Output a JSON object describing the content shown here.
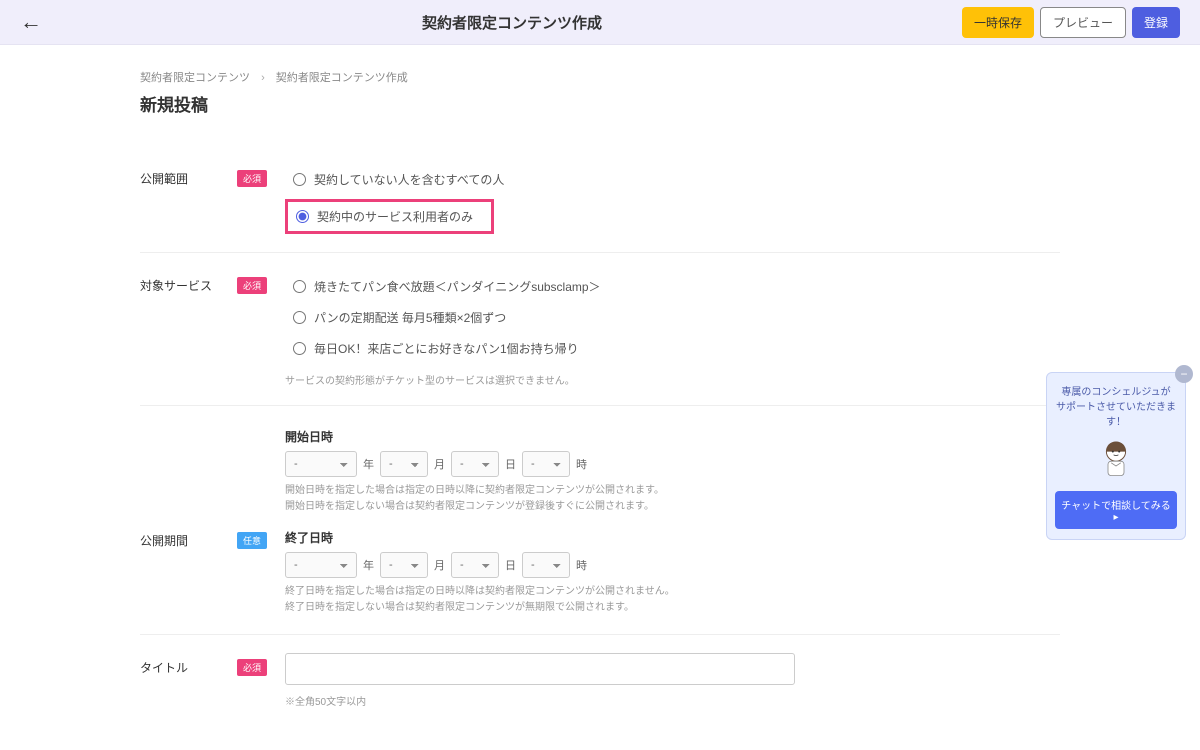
{
  "header": {
    "title": "契約者限定コンテンツ作成",
    "tempSave": "一時保存",
    "preview": "プレビュー",
    "register": "登録"
  },
  "breadcrumb": {
    "root": "契約者限定コンテンツ",
    "current": "契約者限定コンテンツ作成"
  },
  "pageHeading": "新規投稿",
  "sections": {
    "scope": {
      "label": "公開範囲",
      "badge": "必須",
      "opt1": "契約していない人を含むすべての人",
      "opt2": "契約中のサービス利用者のみ"
    },
    "service": {
      "label": "対象サービス",
      "badge": "必須",
      "opt1": "焼きたてパン食べ放題＜パンダイニングsubsclamp＞",
      "opt2": "パンの定期配送 毎月5種類×2個ずつ",
      "opt3": "毎日OK！来店ごとにお好きなパン1個お持ち帰り",
      "note": "サービスの契約形態がチケット型のサービスは選択できません。"
    },
    "period": {
      "label": "公開期間",
      "badge": "任意",
      "startLabel": "開始日時",
      "endLabel": "終了日時",
      "placeholder": "-",
      "unitYear": "年",
      "unitMonth": "月",
      "unitDay": "日",
      "unitHour": "時",
      "startHelp1": "開始日時を指定した場合は指定の日時以降に契約者限定コンテンツが公開されます。",
      "startHelp2": "開始日時を指定しない場合は契約者限定コンテンツが登録後すぐに公開されます。",
      "endHelp1": "終了日時を指定した場合は指定の日時以降は契約者限定コンテンツが公開されません。",
      "endHelp2": "終了日時を指定しない場合は契約者限定コンテンツが無期限で公開されます。"
    },
    "title": {
      "label": "タイトル",
      "badge": "必須",
      "note": "※全角50文字以内"
    }
  },
  "chat": {
    "line1": "専属のコンシェルジュが",
    "line2": "サポートさせていただきます！",
    "button": "チャットで相談してみる ▸"
  }
}
